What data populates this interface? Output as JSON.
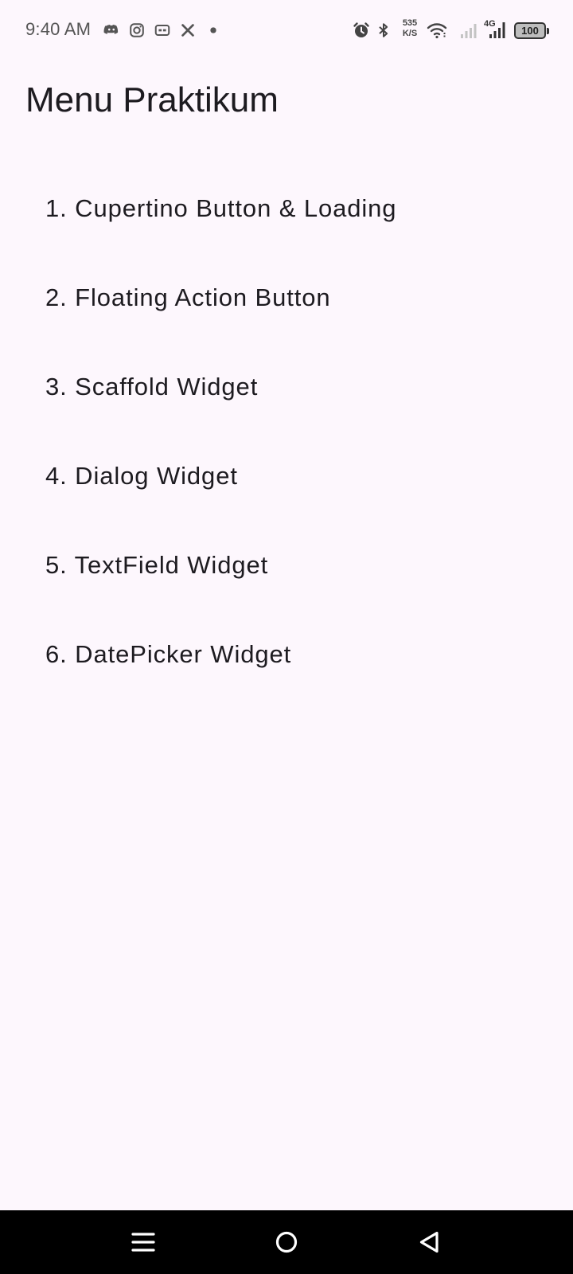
{
  "status_bar": {
    "time": "9:40 AM",
    "net_speed_value": "535",
    "net_speed_unit": "K/S",
    "network_type": "4G",
    "battery_level": "100",
    "icons": [
      "discord-icon",
      "instagram-icon",
      "messenger-icon",
      "x-icon",
      "dot-icon",
      "alarm-icon",
      "bluetooth-icon",
      "wifi-icon",
      "signal-icon",
      "signal-4g-icon",
      "battery-icon"
    ]
  },
  "app_bar": {
    "title": "Menu Praktikum"
  },
  "menu": {
    "items": [
      {
        "label": "1. Cupertino Button & Loading"
      },
      {
        "label": "2. Floating Action Button"
      },
      {
        "label": "3. Scaffold Widget"
      },
      {
        "label": "4. Dialog Widget"
      },
      {
        "label": "5. TextField Widget"
      },
      {
        "label": "6. DatePicker Widget"
      }
    ]
  },
  "nav_bar": {
    "buttons": [
      "menu-icon",
      "home-icon",
      "back-icon"
    ]
  },
  "colors": {
    "background": "#FDF7FD",
    "text": "#1D1B20",
    "nav_bar": "#000000"
  }
}
